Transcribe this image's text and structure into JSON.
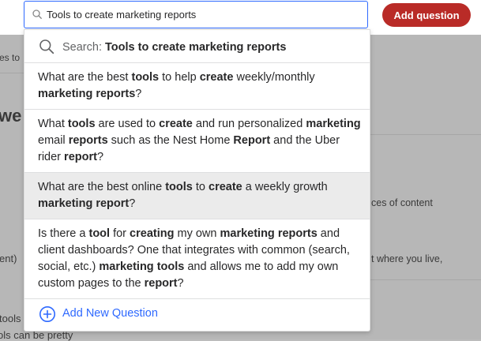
{
  "search": {
    "value": "Tools to create marketing reports",
    "icon": "search-icon"
  },
  "header": {
    "add_question_label": "Add question"
  },
  "dropdown": {
    "search_prefix": "Search:",
    "search_query": "Tools to create marketing reports",
    "suggestions": [
      {
        "segments": [
          {
            "t": "What are the best ",
            "b": false
          },
          {
            "t": "tools",
            "b": true
          },
          {
            "t": " to help ",
            "b": false
          },
          {
            "t": "create",
            "b": true
          },
          {
            "t": " weekly/monthly ",
            "b": false
          },
          {
            "t": "marketing reports",
            "b": true
          },
          {
            "t": "?",
            "b": false
          }
        ]
      },
      {
        "segments": [
          {
            "t": "What ",
            "b": false
          },
          {
            "t": "tools",
            "b": true
          },
          {
            "t": " are used to ",
            "b": false
          },
          {
            "t": "create",
            "b": true
          },
          {
            "t": " and run personalized ",
            "b": false
          },
          {
            "t": "marketing",
            "b": true
          },
          {
            "t": " email ",
            "b": false
          },
          {
            "t": "reports",
            "b": true
          },
          {
            "t": " such as the Nest Home ",
            "b": false
          },
          {
            "t": "Report",
            "b": true
          },
          {
            "t": " and the Uber rider ",
            "b": false
          },
          {
            "t": "report",
            "b": true
          },
          {
            "t": "?",
            "b": false
          }
        ]
      },
      {
        "segments": [
          {
            "t": "What are the best online ",
            "b": false
          },
          {
            "t": "tools",
            "b": true
          },
          {
            "t": " to ",
            "b": false
          },
          {
            "t": "create",
            "b": true
          },
          {
            "t": " a weekly growth ",
            "b": false
          },
          {
            "t": "marketing report",
            "b": true
          },
          {
            "t": "?",
            "b": false
          }
        ]
      },
      {
        "segments": [
          {
            "t": "Is there a ",
            "b": false
          },
          {
            "t": "tool",
            "b": true
          },
          {
            "t": " for ",
            "b": false
          },
          {
            "t": "creating",
            "b": true
          },
          {
            "t": " my own ",
            "b": false
          },
          {
            "t": "marketing reports",
            "b": true
          },
          {
            "t": " and client dashboards? One that integrates with common (search, social, etc.) ",
            "b": false
          },
          {
            "t": "marketing tools",
            "b": true
          },
          {
            "t": " and allows me to add my own custom pages to the ",
            "b": false
          },
          {
            "t": "report",
            "b": true
          },
          {
            "t": "?",
            "b": false
          }
        ]
      }
    ],
    "add_new_label": "Add New Question"
  },
  "background": {
    "fragments": [
      "es to",
      "we",
      "ces of content",
      "ent)",
      "t where you live,",
      "tools",
      "ols can be pretty"
    ]
  },
  "colors": {
    "accent_red": "#b92b27",
    "link_blue": "#2e69ff",
    "highlight": "#ebebeb"
  }
}
